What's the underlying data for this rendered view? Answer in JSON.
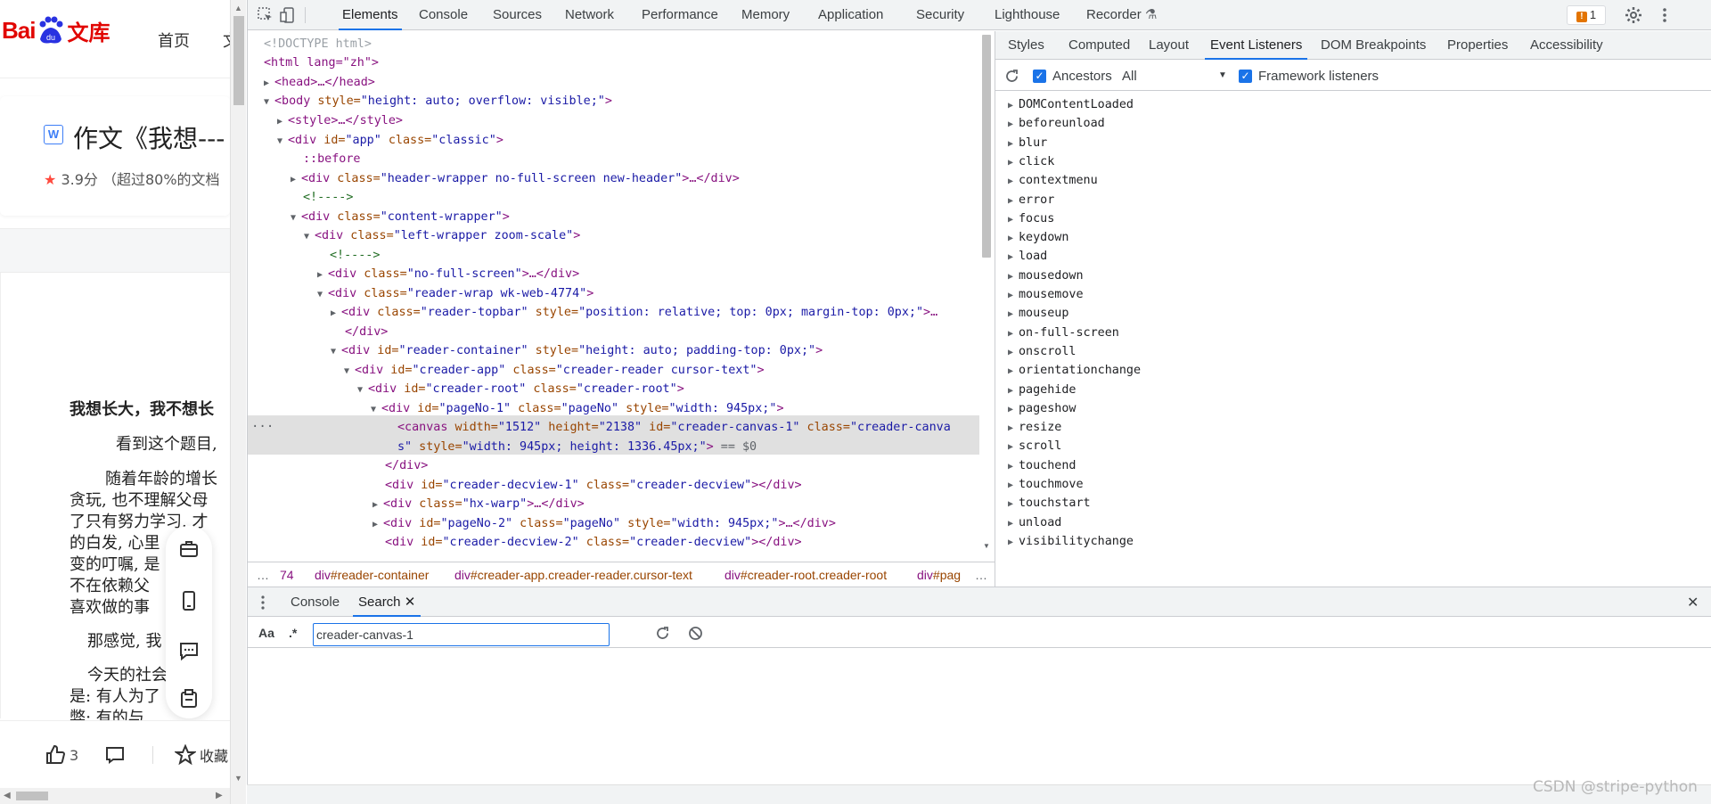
{
  "page": {
    "logo_bai": "Bai",
    "logo_du": "du",
    "logo_wenku": "文库",
    "nav_home": "首页",
    "nav_more": "文",
    "doc_type_badge": "W",
    "doc_title": "作文《我想---",
    "rating_score": "3.9分",
    "rating_note": "（超过80%的文档",
    "doc_lines": [
      "我想长大，我不想长",
      "看到这个题目,",
      "随着年龄的增长",
      "贪玩, 也不理解父母",
      "了只有努力学习. 才",
      "的白发, 心里",
      "变的叮嘱, 是",
      "不在依赖父",
      "喜欢做的事",
      "那感觉, 我",
      "今天的社会, 是",
      "是: 有人为了",
      "弊; 有的与"
    ],
    "like_count": "3",
    "favorite_label": "收藏"
  },
  "devtools": {
    "tabs": [
      "Elements",
      "Console",
      "Sources",
      "Network",
      "Performance",
      "Memory",
      "Application",
      "Security",
      "Lighthouse",
      "Recorder"
    ],
    "issues_count": "1",
    "dom_lines": {
      "doctype": "<!DOCTYPE html>",
      "html_open": "<html lang=\"zh\">",
      "head": "<head>…</head>",
      "body_tag": "<body",
      "body_attr": " style=",
      "body_val": "\"height: auto; overflow: visible;\"",
      "style": "<style>…</style>",
      "app_tag": "<div",
      "app_id_attr": " id=",
      "app_id_val": "\"app\"",
      "app_cls_attr": " class=",
      "app_cls_val": "\"classic\"",
      "before": "::before",
      "header_cls_val": "\"header-wrapper no-full-screen new-header\"",
      "comment": "<!---->",
      "content_cls_val": "\"content-wrapper\"",
      "left_cls_val": "\"left-wrapper zoom-scale\"",
      "nofull_cls_val": "\"no-full-screen\"",
      "reader_wrap_cls_val": "\"reader-wrap wk-web-4774\"",
      "topbar_cls_val": "\"reader-topbar\"",
      "topbar_style_val": "\"position: relative; top: 0px; margin-top: 0px;\"",
      "div_close": "</div>",
      "reader_container_id_val": "\"reader-container\"",
      "reader_container_style_val": "\"height: auto; padding-top: 0px;\"",
      "creader_app_id_val": "\"creader-app\"",
      "creader_app_cls_val": "\"creader-reader cursor-text\"",
      "creader_root_id_val": "\"creader-root\"",
      "creader_root_cls_val": "\"creader-root\"",
      "pageno1_id_val": "\"pageNo-1\"",
      "pageno_cls_val": "\"pageNo\"",
      "pageno_style_val": "\"width: 945px;\"",
      "canvas_width_val": "\"1512\"",
      "canvas_height_val": "\"2138\"",
      "canvas_id_val": "\"creader-canvas-1\"",
      "canvas_cls_val_1": "\"creader-canva",
      "canvas_cls_val_2": "s\"",
      "canvas_style_val": "\"width: 945px; height: 1336.45px;\"",
      "eq0": "== $0",
      "decview1_id_val": "\"creader-decview-1\"",
      "decview_cls_val": "\"creader-decview\"",
      "hx_cls_val": "\"hx-warp\"",
      "pageno2_id_val": "\"pageNo-2\"",
      "decview2_id_val": "\"creader-decview-2\""
    },
    "breadcrumbs": [
      {
        "tag": "…",
        "cls": "",
        "id": ""
      },
      {
        "tag": "74",
        "cls": "",
        "id": ""
      },
      {
        "tag": "div",
        "id": "#reader-container",
        "cls": ""
      },
      {
        "tag": "div",
        "id": "#creader-app",
        "cls": ".creader-reader.cursor-text"
      },
      {
        "tag": "div",
        "id": "#creader-root",
        "cls": ".creader-root"
      },
      {
        "tag": "div",
        "id": "#pag",
        "cls": ""
      }
    ],
    "sidebar_tabs": [
      "Styles",
      "Computed",
      "Layout",
      "Event Listeners",
      "DOM Breakpoints",
      "Properties",
      "Accessibility"
    ],
    "ancestors_label": "Ancestors",
    "ancestors_filter": "All",
    "framework_label": "Framework listeners",
    "events": [
      "DOMContentLoaded",
      "beforeunload",
      "blur",
      "click",
      "contextmenu",
      "error",
      "focus",
      "keydown",
      "load",
      "mousedown",
      "mousemove",
      "mouseup",
      "on-full-screen",
      "onscroll",
      "orientationchange",
      "pagehide",
      "pageshow",
      "resize",
      "scroll",
      "touchend",
      "touchmove",
      "touchstart",
      "unload",
      "visibilitychange"
    ],
    "drawer_tabs": [
      "Console",
      "Search"
    ],
    "search_case_label": "Aa",
    "search_regex_label": ".*",
    "search_value": "creader-canvas-1"
  },
  "watermark": "CSDN @stripe-python",
  "colors": {
    "accent": "#1a73e8",
    "baidu_red": "#e10602",
    "tag": "#881280",
    "attr": "#994500",
    "value": "#1a1aa6"
  }
}
